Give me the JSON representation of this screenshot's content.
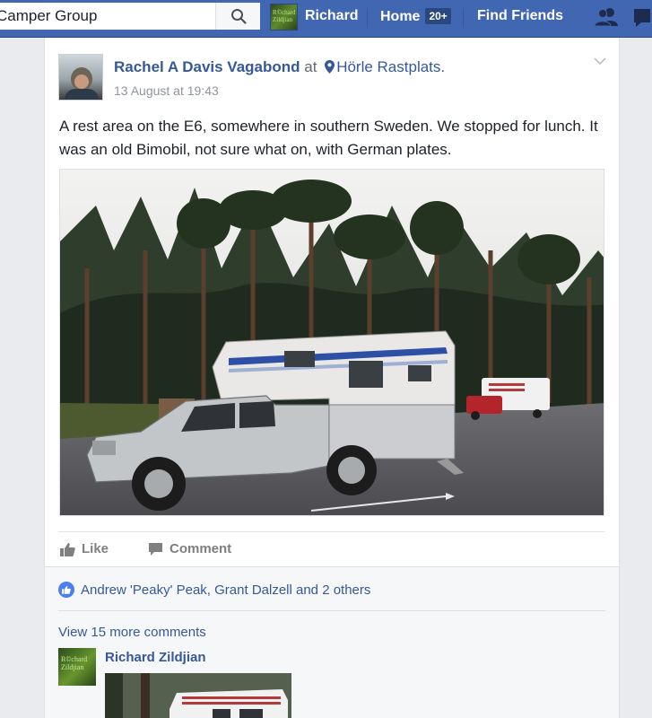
{
  "topbar": {
    "search_value": "Camper Group",
    "search_placeholder": "Search",
    "user_name": "Richard",
    "home_label": "Home",
    "home_badge": "20+",
    "find_friends_label": "Find Friends",
    "avatar_text": "R©chard Zildjian",
    "bar_color": "#4267b2"
  },
  "post": {
    "author": "Rachel A Davis Vagabond",
    "at_word": "at",
    "location": "Hörle Rastplats.",
    "timestamp": "13 August at 19:43",
    "text": "A rest area on the E6, somewhere in southern Sweden. We stopped for lunch. It was an old Bimobil, not sure what on, with German plates.",
    "photo_subject": "camper-on-pickup-in-pine-forest",
    "like_label": "Like",
    "comment_label": "Comment"
  },
  "reactions": {
    "likers_text": "Andrew 'Peaky' Peak, Grant Dalzell and 2 others"
  },
  "comments": {
    "view_more": "View 15 more comments",
    "first": {
      "author": "Richard Zildjian",
      "avatar_text": "R©chard Zildjian"
    }
  }
}
